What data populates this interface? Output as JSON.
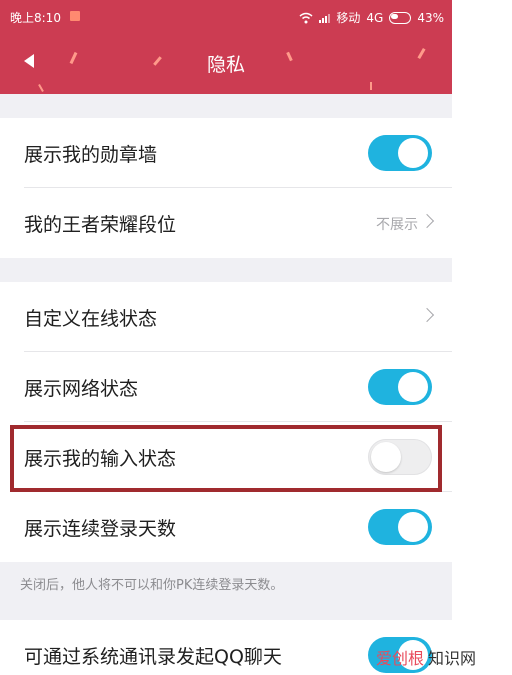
{
  "status_bar": {
    "time": "晚上8:10",
    "carrier": "移动",
    "network": "4G",
    "battery": "43%"
  },
  "header": {
    "title": "隐私"
  },
  "rows": [
    {
      "label": "展示我的勋章墙",
      "toggle": "on"
    },
    {
      "label": "我的王者荣耀段位",
      "value": "不展示"
    },
    {
      "label": "自定义在线状态"
    },
    {
      "label": "展示网络状态",
      "toggle": "on"
    },
    {
      "label": "展示我的输入状态",
      "toggle": "off"
    },
    {
      "label": "展示连续登录天数",
      "toggle": "on"
    },
    {
      "label": "可通过系统通讯录发起QQ聊天",
      "toggle": "on"
    }
  ],
  "footnote": "关闭后，他人将不可以和你PK连续登录天数。",
  "watermark": {
    "logo": "爱创根",
    "text": "知识网"
  },
  "colors": {
    "header": "#cc3c52",
    "toggle_on": "#1fb3df",
    "highlight": "#a02a2e"
  }
}
